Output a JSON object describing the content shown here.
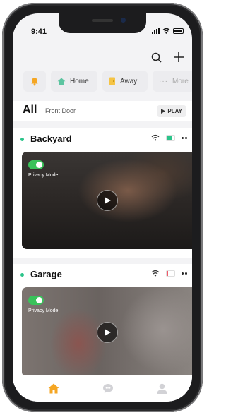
{
  "status": {
    "time": "9:41"
  },
  "modes": [
    {
      "label": "Home",
      "icon": "home-icon"
    },
    {
      "label": "Away",
      "icon": "door-icon"
    },
    {
      "label": "More",
      "icon": "more-icon"
    }
  ],
  "filter": {
    "title": "All",
    "location": "Front Door",
    "play_label": "PLAY"
  },
  "cameras": [
    {
      "name": "Backyard",
      "privacy_label": "Privacy  Mode",
      "privacy_on": true,
      "battery_color": "#2bc48a",
      "battery_level": 0.6
    },
    {
      "name": "Garage",
      "privacy_label": "Privacy  Mode",
      "privacy_on": true,
      "battery_color": "#f05a6a",
      "battery_level": 0.2
    }
  ],
  "colors": {
    "accent": "#f5a623",
    "online": "#2bc48a",
    "toggle_on": "#39c25a"
  }
}
